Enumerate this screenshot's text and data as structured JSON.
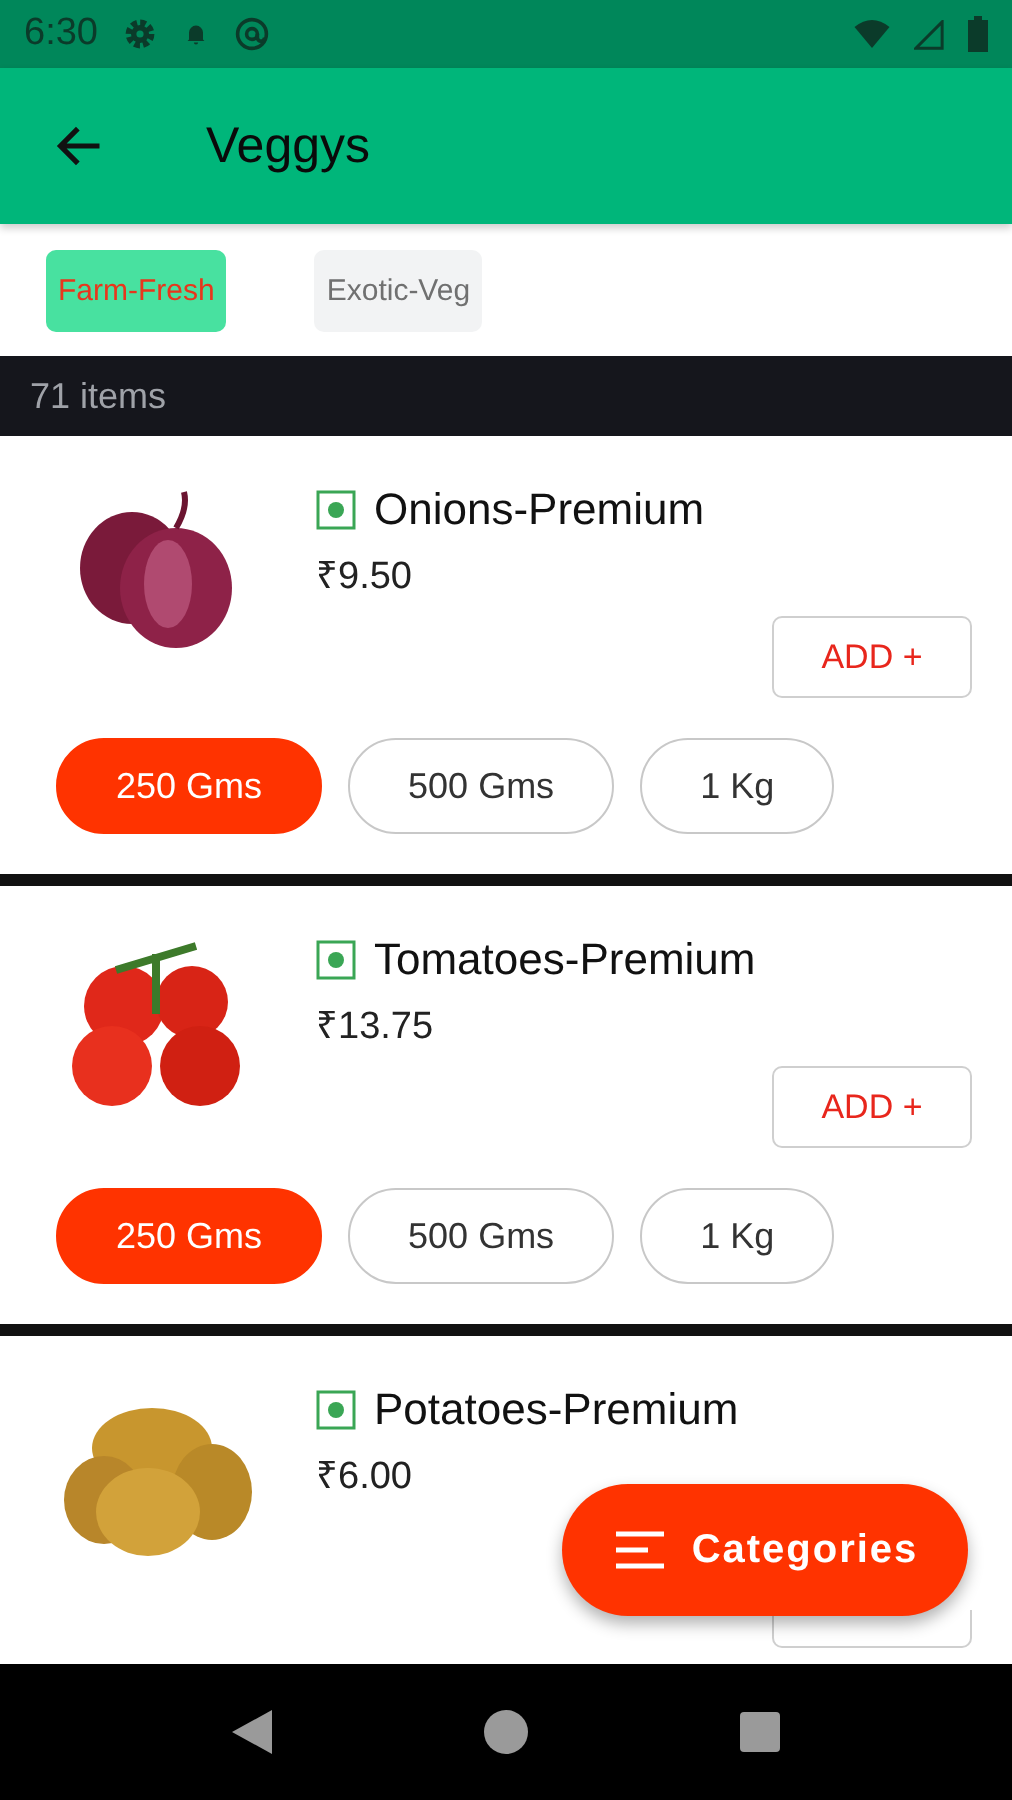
{
  "status_bar": {
    "time": "6:30"
  },
  "app_bar": {
    "title": "Veggys"
  },
  "filters": [
    {
      "label": "Farm-Fresh",
      "selected": true
    },
    {
      "label": "Exotic-Veg",
      "selected": false
    }
  ],
  "item_count": "71 items",
  "products": [
    {
      "name": "Onions-Premium",
      "price": "₹9.50",
      "add": "ADD +",
      "sizes": [
        {
          "label": "250 Gms",
          "selected": true
        },
        {
          "label": "500 Gms",
          "selected": false
        },
        {
          "label": "1 Kg",
          "selected": false
        }
      ]
    },
    {
      "name": "Tomatoes-Premium",
      "price": "₹13.75",
      "add": "ADD +",
      "sizes": [
        {
          "label": "250 Gms",
          "selected": true
        },
        {
          "label": "500 Gms",
          "selected": false
        },
        {
          "label": "1 Kg",
          "selected": false
        }
      ]
    },
    {
      "name": "Potatoes-Premium",
      "price": "₹6.00"
    }
  ],
  "fab": {
    "label": "Categories"
  }
}
